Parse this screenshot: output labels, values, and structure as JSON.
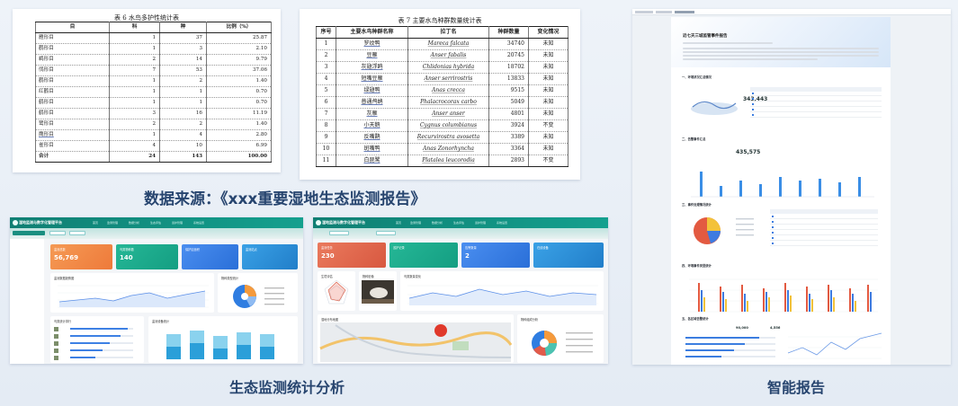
{
  "captions": {
    "data_source": "数据来源：《xxx重要湿地生态监测报告》",
    "eco_stats": "生态监测统计分析",
    "smart_report": "智能报告"
  },
  "table6": {
    "caption": "表 6  水鸟多护性统计表",
    "headers": [
      "目",
      "科",
      "种",
      "比例（%）"
    ],
    "rows": [
      [
        "雁形目",
        "1",
        "37",
        "25.87"
      ],
      [
        "鹳形目",
        "1",
        "3",
        "2.10"
      ],
      [
        "鹈形目",
        "2",
        "14",
        "9.79"
      ],
      [
        "鸻形目",
        "7",
        "53",
        "37.06"
      ],
      [
        "鹳形目",
        "1",
        "2",
        "1.40"
      ],
      [
        "红鹳目",
        "1",
        "1",
        "0.70"
      ],
      [
        "鹤形目",
        "1",
        "1",
        "0.70"
      ],
      [
        "鹤形目",
        "3",
        "16",
        "11.19"
      ],
      [
        "鹭形目",
        "2",
        "2",
        "1.40"
      ],
      [
        "鹰形目",
        "1",
        "4",
        "2.80"
      ],
      [
        "雀形目",
        "4",
        "10",
        "6.99"
      ],
      [
        "合计",
        "24",
        "143",
        "100.00"
      ]
    ]
  },
  "table7": {
    "caption": "表 7  主要水鸟种群数量统计表",
    "headers": [
      "序号",
      "主要水鸟种群名称",
      "拉丁名",
      "种群数量",
      "变化情况"
    ],
    "rows": [
      [
        "1",
        "罗纹鸭",
        "Mareca falcata",
        "34740",
        "未知"
      ],
      [
        "2",
        "豆雁",
        "Anser fabalis",
        "20745",
        "未知"
      ],
      [
        "3",
        "灰翅浮鸥",
        "Chlidonias hybrida",
        "18702",
        "未知"
      ],
      [
        "4",
        "短嘴豆雁",
        "Anser serrirostris",
        "13833",
        "未知"
      ],
      [
        "5",
        "绿翅鸭",
        "Anas crecca",
        "9515",
        "未知"
      ],
      [
        "6",
        "普通鸬鹚",
        "Phalacrocorax carbo",
        "5049",
        "未知"
      ],
      [
        "7",
        "灰雁",
        "Anser anser",
        "4801",
        "未知"
      ],
      [
        "8",
        "小天鹅",
        "Cygnus columbianus",
        "3924",
        "不变"
      ],
      [
        "9",
        "反嘴鹬",
        "Recurvirostra avosetta",
        "3389",
        "未知"
      ],
      [
        "10",
        "斑嘴鸭",
        "Anas Zonorhyncha",
        "3364",
        "未知"
      ],
      [
        "11",
        "白琵鹭",
        "Platalea leucorodia",
        "2893",
        "不变"
      ]
    ]
  },
  "dashboard_a": {
    "title": "湿地监测与数字化管理平台",
    "nav": [
      "首页",
      "监测管理",
      "数据分析",
      "生态评估",
      "巡护管理",
      "系统设置"
    ],
    "kpi": [
      {
        "label": "监测总数",
        "value": "56,769",
        "color": "#f08a4b"
      },
      {
        "label": "鸟类物种数",
        "value": "140",
        "color": "#1cab8d"
      },
      {
        "label": "保护区面积",
        "value": "",
        "color": "#2f7de1"
      },
      {
        "label": "监测站点",
        "value": "",
        "color": "#2f8fd6"
      }
    ],
    "cards": {
      "trend": "监测数据趋势图",
      "pie": "物种类型统计",
      "rank": "鸟类统计排行",
      "bars": "监测设备统计"
    }
  },
  "dashboard_b": {
    "title": "湿地监测与数字化管理平台",
    "kpi": [
      {
        "label": "监测任务",
        "value": "230",
        "color": "#e26a52"
      },
      {
        "label": "巡护记录",
        "value": "",
        "color": "#1cab8d"
      },
      {
        "label": "告警数量",
        "value": "2",
        "color": "#2f7de1"
      },
      {
        "label": "在线设备",
        "value": "",
        "color": "#2f8fd6"
      }
    ],
    "cards": {
      "radar": "生境评估",
      "photo": "物种影像",
      "line": "鸟类数量变化",
      "map": "湿地分布地图",
      "pie": "物种组成分析"
    }
  },
  "report": {
    "title": "近七天三城监管事件报告",
    "sections": [
      "一、环境状况汇总情况",
      "二、告警事件汇总",
      "三、事件处理情况统计",
      "四、环境事件类型统计",
      "五、各区域告警统计"
    ],
    "numbers": {
      "first": "343,443",
      "second": "435,575",
      "third1": "90,000",
      "third2": "4,556"
    }
  },
  "colors": {
    "caption": "#27456f",
    "teal": "#0f7f73"
  }
}
